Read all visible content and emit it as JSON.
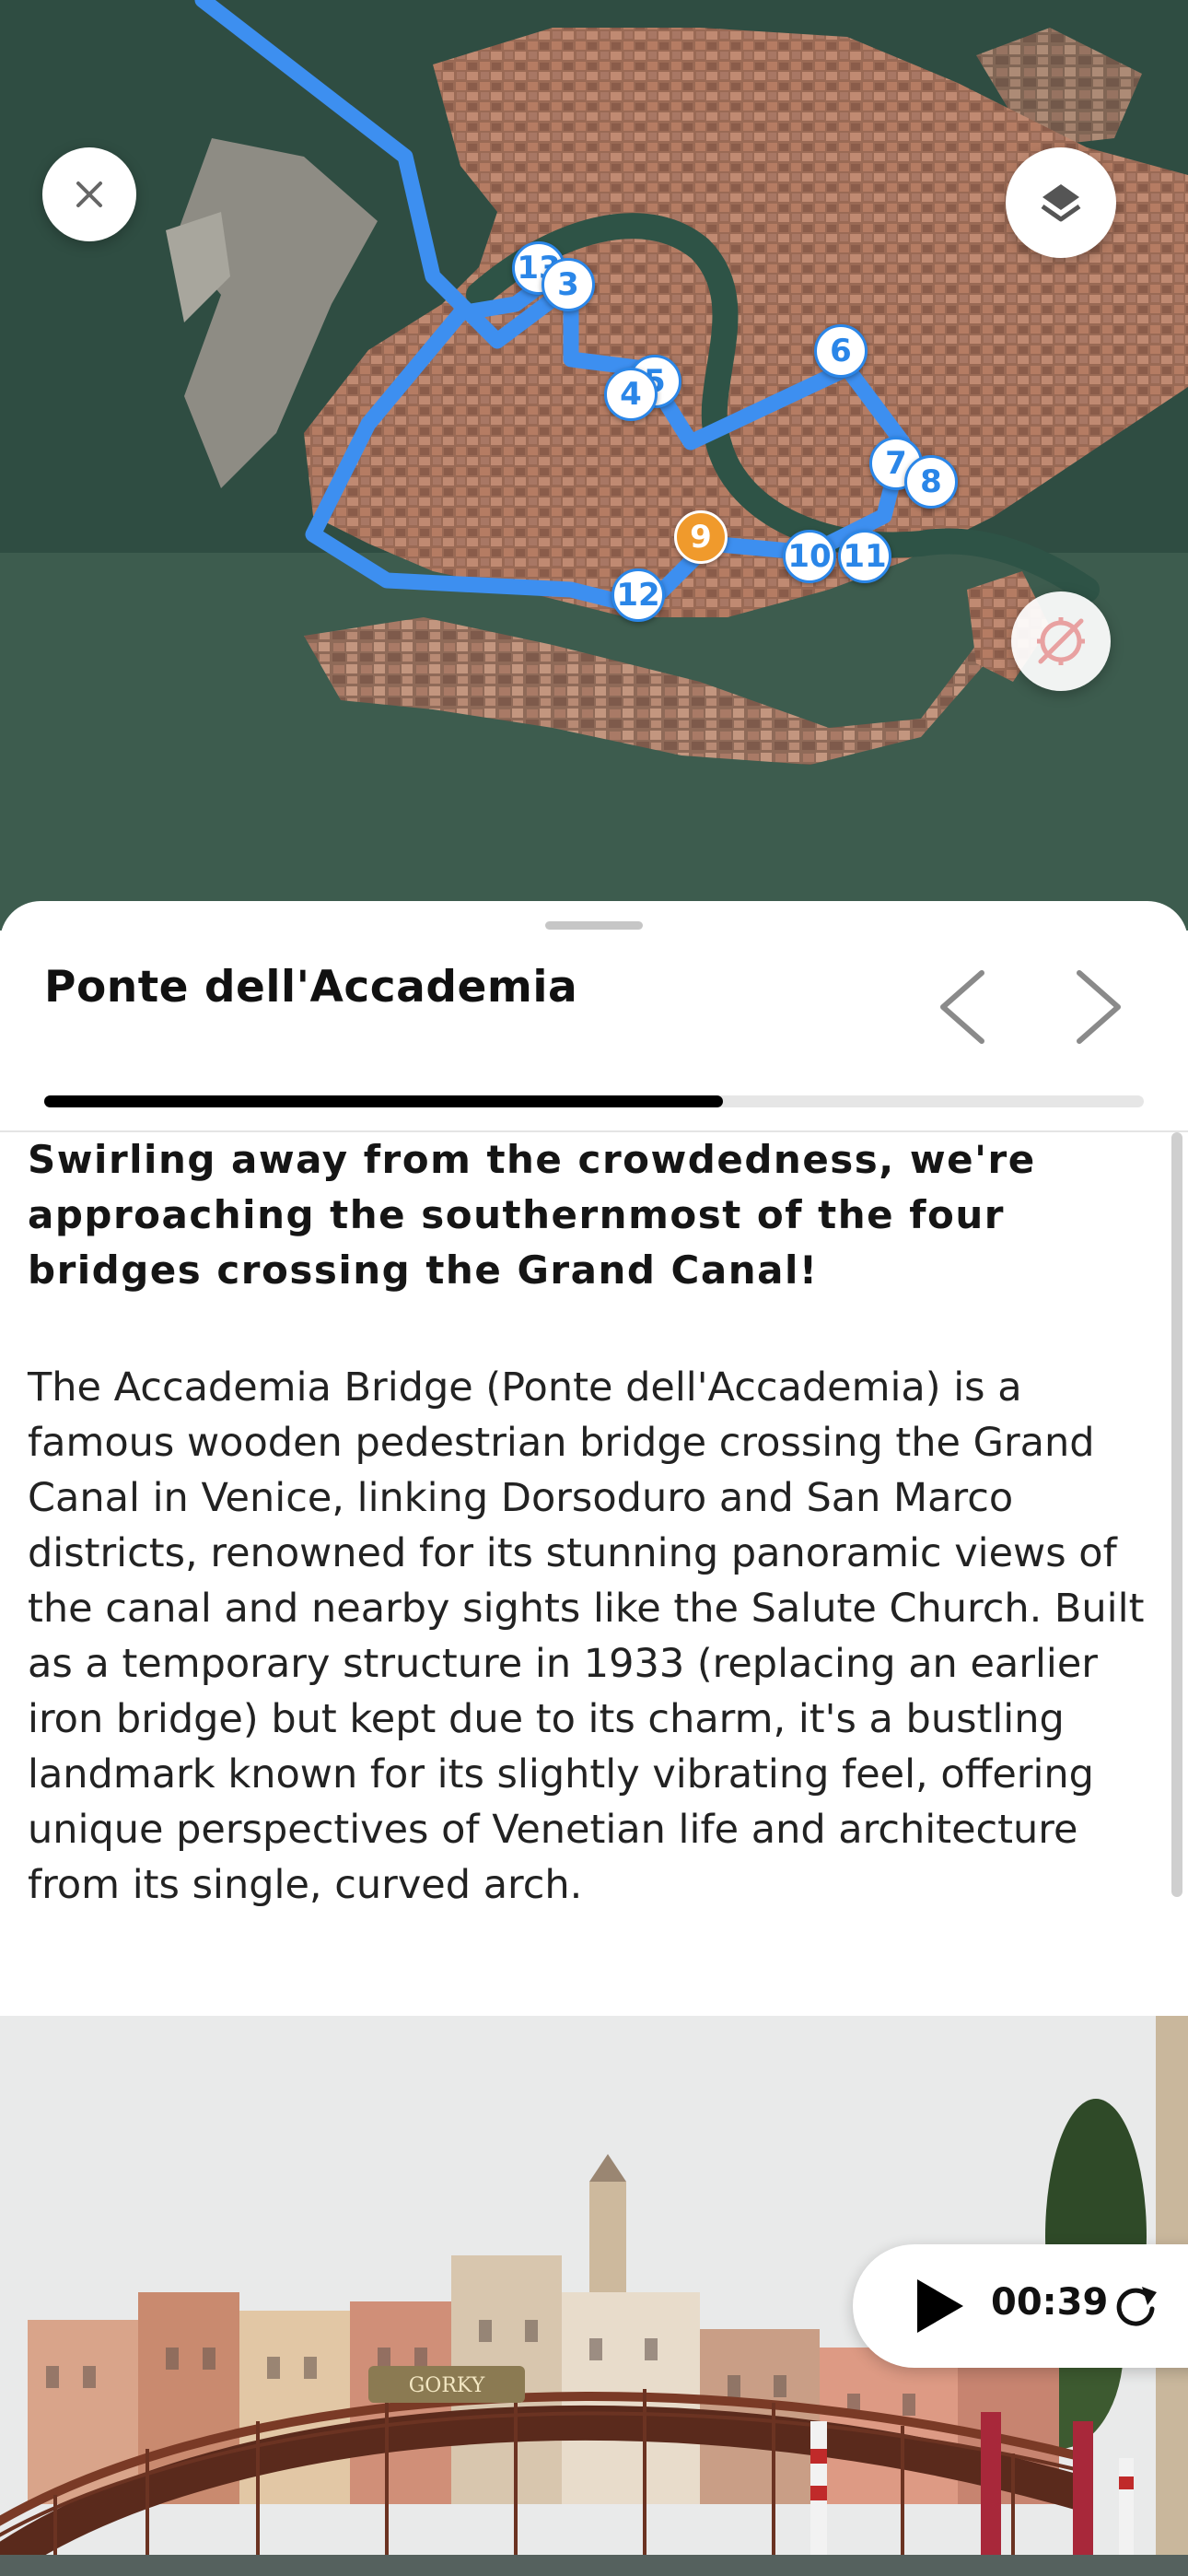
{
  "map": {
    "buttons": {
      "close_icon": "close-icon",
      "layers_icon": "layers-icon",
      "compass_icon": "compass-off-icon"
    },
    "route_color": "#3d8ff0",
    "markers": [
      {
        "label": "13",
        "active": false
      },
      {
        "label": "3",
        "active": false
      },
      {
        "label": "5",
        "active": false
      },
      {
        "label": "4",
        "active": false
      },
      {
        "label": "6",
        "active": false
      },
      {
        "label": "7",
        "active": false
      },
      {
        "label": "8",
        "active": false
      },
      {
        "label": "9",
        "active": true
      },
      {
        "label": "10",
        "active": false
      },
      {
        "label": "11",
        "active": false
      },
      {
        "label": "12",
        "active": false
      }
    ],
    "active_marker_color": "#f09a2c"
  },
  "sheet": {
    "title": "Ponte dell'Accademia",
    "progress": 0.617,
    "intro": "Swirling away from the crowdedness, we're approaching the southernmost of the four bridges crossing the Grand Canal!",
    "description": "The Accademia Bridge (Ponte dell'Accademia) is a famous wooden pedestrian bridge crossing the Grand Canal in Venice, linking Dorsoduro and San Marco districts, renowned for its stunning panoramic views of the canal and nearby sights like the Salute Church. Built as a temporary structure in 1933 (replacing an earlier iron bridge) but kept due to its charm, it's a bustling landmark known for its slightly vibrating feel, offering unique perspectives of Venetian life and architecture from its single, curved arch."
  },
  "audio": {
    "time": "00:39",
    "play_icon": "play-icon",
    "replay_icon": "replay-icon"
  },
  "photo": {
    "sign_text": "GORKY"
  }
}
